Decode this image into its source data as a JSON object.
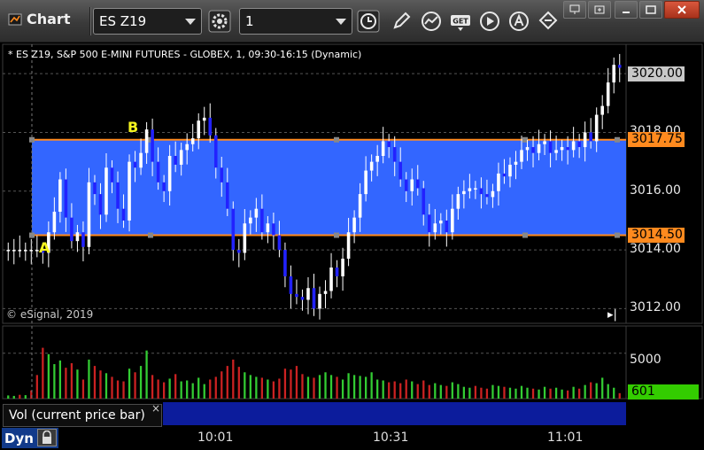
{
  "window": {
    "title": "Chart"
  },
  "toolbar": {
    "symbol": "ES Z19",
    "interval": "1",
    "buttons": [
      "settings-icon",
      "clock-icon",
      "pencil-icon",
      "study-icon",
      "get-icon",
      "play-icon",
      "alert-icon",
      "link-icon"
    ]
  },
  "header": {
    "text": "* ES Z19, S&P 500 E-MINI FUTURES - GLOBEX, 1, 09:30-16:15 (Dynamic)"
  },
  "watermark": "© eSignal, 2019",
  "annotations": {
    "a": "A",
    "b": "B"
  },
  "price_axis": {
    "labels": [
      "3012.00",
      "3014.00",
      "3016.00",
      "3018.00",
      "3020.00"
    ],
    "last_price": "3020.00",
    "upper_line": "3017.75",
    "lower_line": "3014.50"
  },
  "volume_axis": {
    "labels": [
      "5000"
    ],
    "current": "601"
  },
  "volume_pane": {
    "label": "Vol (current price bar)",
    "close": "×"
  },
  "status": {
    "mode": "Dyn"
  },
  "time_axis": {
    "labels": [
      "10:01",
      "10:31",
      "11:01"
    ]
  },
  "colors": {
    "background": "#000000",
    "range_fill": "#3366ff",
    "range_line": "#ff8a1e",
    "candle_blue": "#2222ff",
    "candle_white": "#ffffff",
    "vol_green": "#33cc33",
    "vol_red": "#cc2222",
    "current_vol_bg": "#33cc00"
  },
  "chart_data": {
    "type": "candlestick",
    "ylim": [
      3011.5,
      3021.0
    ],
    "range_box": {
      "upper": 3017.75,
      "lower": 3014.5
    },
    "closes": [
      3014.0,
      3014.0,
      3014.0,
      3014.0,
      3014.0,
      3014.0,
      3013.9,
      3014.6,
      3015.3,
      3016.4,
      3015.1,
      3014.3,
      3014.6,
      3014.1,
      3016.3,
      3015.9,
      3015.2,
      3016.8,
      3016.3,
      3015.4,
      3015.0,
      3017.0,
      3016.8,
      3017.3,
      3018.1,
      3017.0,
      3016.3,
      3016.0,
      3017.2,
      3016.9,
      3017.4,
      3017.6,
      3017.8,
      3018.4,
      3018.5,
      3017.9,
      3016.8,
      3016.3,
      3015.4,
      3014.0,
      3013.9,
      3014.9,
      3015.1,
      3015.4,
      3014.6,
      3014.9,
      3014.5,
      3014.0,
      3013.1,
      3012.5,
      3012.4,
      3012.3,
      3012.7,
      3012.0,
      3012.5,
      3012.6,
      3013.4,
      3013.1,
      3013.7,
      3014.6,
      3015.1,
      3015.9,
      3016.7,
      3017.0,
      3017.2,
      3017.7,
      3017.5,
      3017.0,
      3016.4,
      3016.0,
      3016.4,
      3016.1,
      3015.2,
      3014.6,
      3014.9,
      3015.0,
      3014.6,
      3015.4,
      3015.9,
      3016.0,
      3016.1,
      3016.1,
      3015.9,
      3015.8,
      3016.0,
      3016.6,
      3016.5,
      3016.9,
      3017.0,
      3017.4,
      3017.5,
      3017.3,
      3017.6,
      3017.7,
      3017.3,
      3017.4,
      3017.5,
      3017.4,
      3017.7,
      3017.5,
      3018.0,
      3017.7,
      3018.6,
      3018.9,
      3019.7,
      3020.3,
      3020.2
    ],
    "volume_ylim": [
      0,
      8000
    ],
    "volume": [
      350,
      300,
      420,
      380,
      900,
      2600,
      5600,
      4900,
      3800,
      4200,
      3400,
      3900,
      3200,
      2100,
      4300,
      3600,
      3100,
      2800,
      2400,
      2000,
      1900,
      3300,
      2900,
      3600,
      5300,
      2600,
      2100,
      1800,
      2200,
      2700,
      1900,
      2000,
      1700,
      2300,
      1600,
      2100,
      2400,
      3000,
      3600,
      4300,
      3500,
      2900,
      2600,
      2400,
      2300,
      2100,
      1900,
      2200,
      3300,
      3200,
      3600,
      2700,
      2400,
      2300,
      2600,
      2900,
      2600,
      2400,
      2100,
      2800,
      2600,
      2500,
      2400,
      2900,
      2100,
      2000,
      1800,
      1900,
      1700,
      2100,
      1900,
      1600,
      2000,
      1500,
      1700,
      1500,
      1400,
      1800,
      1600,
      1300,
      1200,
      1400,
      1200,
      1100,
      1500,
      1400,
      1300,
      1200,
      1100,
      1400,
      1200,
      1100,
      1000,
      1300,
      1100,
      1200,
      1000,
      900,
      1300,
      1100,
      1500,
      1800,
      1700,
      2300,
      1600,
      1200,
      601
    ],
    "volume_up": [
      true,
      true,
      false,
      true,
      false,
      false,
      false,
      true,
      true,
      true,
      false,
      false,
      true,
      false,
      true,
      false,
      false,
      true,
      false,
      false,
      false,
      true,
      false,
      true,
      true,
      false,
      false,
      false,
      true,
      false,
      true,
      true,
      true,
      true,
      true,
      false,
      false,
      false,
      false,
      false,
      false,
      true,
      true,
      true,
      false,
      true,
      false,
      false,
      false,
      false,
      false,
      false,
      true,
      false,
      true,
      true,
      true,
      false,
      true,
      true,
      true,
      true,
      true,
      true,
      true,
      true,
      false,
      false,
      false,
      false,
      true,
      false,
      false,
      false,
      true,
      true,
      false,
      true,
      true,
      true,
      true,
      false,
      false,
      false,
      true,
      true,
      false,
      true,
      true,
      true,
      true,
      false,
      true,
      true,
      false,
      true,
      true,
      false,
      true,
      false,
      true,
      false,
      true,
      true,
      true,
      true,
      false
    ]
  }
}
